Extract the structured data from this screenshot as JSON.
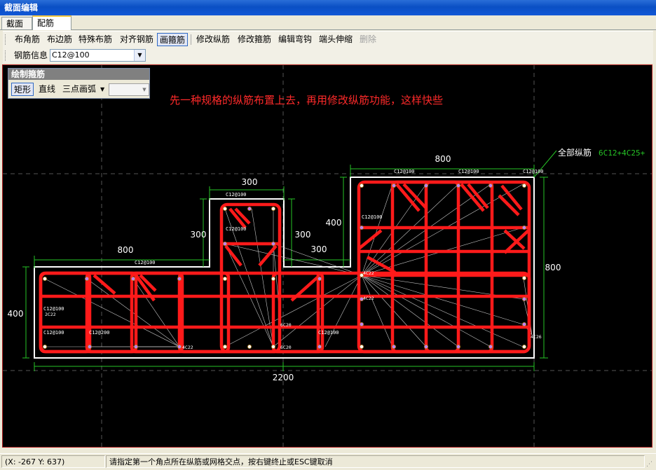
{
  "window": {
    "title": "截面编辑"
  },
  "tabs": [
    {
      "label": "截面"
    },
    {
      "label": "配筋",
      "active": true
    }
  ],
  "toolbar": {
    "buttons": [
      {
        "label": "布角筋"
      },
      {
        "label": "布边筋"
      },
      {
        "label": "特殊布筋"
      },
      {
        "label": "对齐钢筋"
      },
      {
        "label": "画箍筋",
        "pressed": true
      },
      {
        "label": "修改纵筋"
      },
      {
        "label": "修改箍筋"
      },
      {
        "label": "编辑弯钩"
      },
      {
        "label": "端头伸缩"
      },
      {
        "label": "删除",
        "disabled": true
      }
    ],
    "rebar_info_label": "钢筋信息",
    "rebar_info_value": "C12@100"
  },
  "draw_panel": {
    "title": "绘制箍筋",
    "modes": [
      {
        "label": "矩形",
        "pressed": true
      },
      {
        "label": "直线"
      },
      {
        "label": "三点画弧"
      }
    ],
    "combo_value": ""
  },
  "canvas": {
    "note": "先一种规格的纵筋布置上去，再用修改纵筋功能，这样快些",
    "longitudinal_label": "全部纵筋",
    "longitudinal_value": "6C12+4C25+",
    "dimensions": {
      "total_width": "2200",
      "left_wing_width": "800",
      "left_height": "400",
      "tab_width": "300",
      "tab_left": "300",
      "tab_right": "300",
      "tab_bottom_right": "300",
      "right_block_width": "800",
      "right_block_height": "800",
      "right_upper": "400"
    },
    "stirrup_labels": [
      "C12@100",
      "C12@100",
      "C12@100",
      "C12@100",
      "C12@100",
      "C12@100",
      "C12@100",
      "C12@100",
      "C12@200",
      "C12@100",
      "C12@100"
    ],
    "bar_labels": [
      "6C20",
      "6C20",
      "4C22",
      "2C22",
      "4C22",
      "4C26",
      "4C22"
    ],
    "colors": {
      "background": "#000000",
      "stirrup": "#ff1a1a",
      "outline": "#ffffff",
      "dimension": "#26c426",
      "note": "#ff2a2a",
      "value_text": "#26c426"
    }
  },
  "status": {
    "coords": "(X: -267 Y: 637)",
    "prompt": "请指定第一个角点所在纵筋或网格交点，按右键终止或ESC键取消"
  }
}
